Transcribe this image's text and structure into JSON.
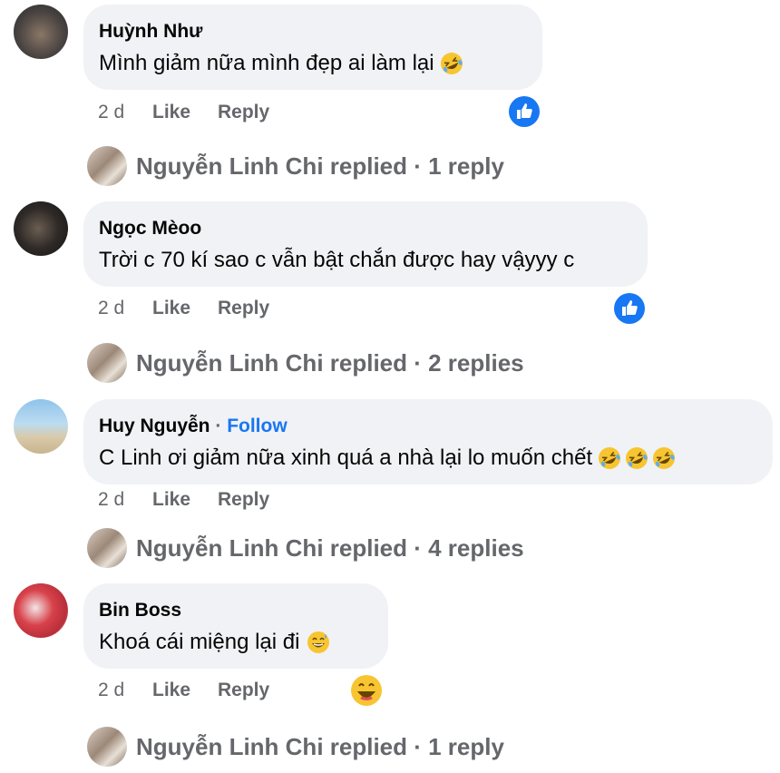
{
  "comments": [
    {
      "author": "Huỳnh Như",
      "text": "Mình giảm nữa mình đẹp ai làm lại",
      "emojis": [
        "rofl-emoji"
      ],
      "time": "2 d",
      "like_label": "Like",
      "reply_label": "Reply",
      "reaction": "like-reaction-icon",
      "replies": {
        "author": "Nguyễn Linh Chi",
        "text": "Nguyễn Linh Chi replied · 1 reply"
      }
    },
    {
      "author": "Ngọc Mèoo",
      "text": "Trời c 70 kí sao c vẫn bật chắn được hay vậyyy c",
      "emojis": [],
      "time": "2 d",
      "like_label": "Like",
      "reply_label": "Reply",
      "reaction": "like-reaction-icon",
      "replies": {
        "author": "Nguyễn Linh Chi",
        "text": "Nguyễn Linh Chi replied · 2 replies"
      }
    },
    {
      "author": "Huy Nguyễn",
      "follow_label": "Follow",
      "text": "C Linh ơi giảm nữa xinh quá a nhà lại lo muốn chết",
      "emojis": [
        "rofl-emoji",
        "rofl-emoji",
        "rofl-emoji"
      ],
      "time": "2 d",
      "like_label": "Like",
      "reply_label": "Reply",
      "replies": {
        "author": "Nguyễn Linh Chi",
        "text": "Nguyễn Linh Chi replied · 4 replies"
      }
    },
    {
      "author": "Bin Boss",
      "text": "Khoá cái miệng lại đi",
      "emojis": [
        "grinning-sweat-emoji"
      ],
      "time": "2 d",
      "like_label": "Like",
      "reply_label": "Reply",
      "reaction": "haha-reaction-icon",
      "replies": {
        "author": "Nguyễn Linh Chi",
        "text": "Nguyễn Linh Chi replied · 1 reply"
      }
    }
  ],
  "colors": {
    "bubble": "#f0f2f5",
    "secondary_text": "#65676b",
    "link_blue": "#1877f2",
    "like_blue": "#1877f2",
    "emoji_yellow": "#f7c531"
  }
}
